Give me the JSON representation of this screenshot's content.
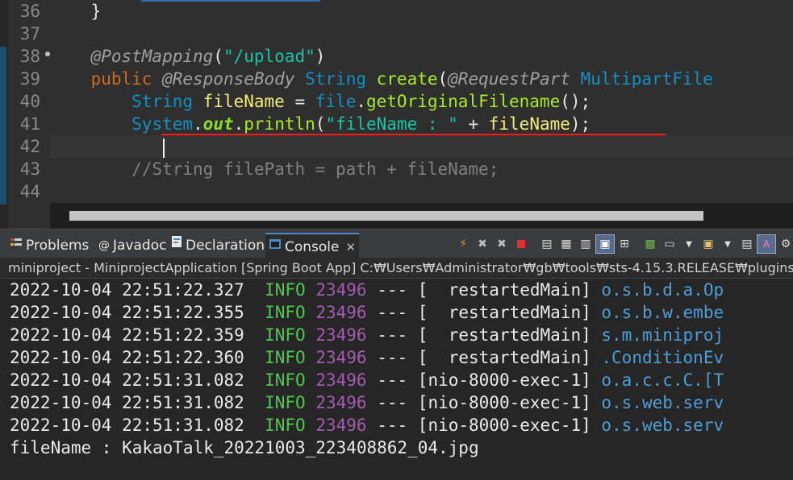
{
  "editor": {
    "line_numbers": [
      "36",
      "37",
      "38",
      "39",
      "40",
      "41",
      "42",
      "43",
      "44"
    ],
    "lines": {
      "l36": {
        "brace": "}"
      },
      "l38": {
        "ann": "@PostMapping",
        "open": "(",
        "str": "\"/upload\"",
        "close": ")"
      },
      "l39": {
        "kw": "public",
        "ann1": "@ResponseBody",
        "type1": "String",
        "method": "create",
        "open": "(",
        "ann2": "@RequestPart",
        "type2": "MultipartFile"
      },
      "l40": {
        "type": "String",
        "var": "fileName",
        "eq": " = ",
        "obj": "file",
        "dot": ".",
        "method": "getOriginalFilename",
        "end": "();"
      },
      "l41": {
        "cls": "System",
        "dot1": ".",
        "field": "out",
        "dot2": ".",
        "method": "println",
        "open": "(",
        "str": "\"fileName : \"",
        "plus": " + ",
        "var": "fileName",
        "end": ");"
      },
      "l43": {
        "comment": "//String filePath = path + fileName;"
      }
    }
  },
  "tabs": [
    {
      "label": "Problems",
      "icon": "problems-icon"
    },
    {
      "label": "Javadoc",
      "icon": "javadoc-icon"
    },
    {
      "label": "Declaration",
      "icon": "declaration-icon"
    },
    {
      "label": "Console",
      "icon": "console-icon",
      "close": "✕"
    }
  ],
  "console": {
    "header": "miniproject - MiniprojectApplication [Spring Boot App] C:₩Users₩Administrator₩gb₩tools₩sts-4.15.3.RELEASE₩plugins",
    "rows": [
      {
        "ts": "2022-10-04 22:51:22.327",
        "level": "INFO",
        "pid": "23496",
        "sep": "---",
        "thread": "[  restartedMain]",
        "logger": "o.s.b.d.a.Op"
      },
      {
        "ts": "2022-10-04 22:51:22.355",
        "level": "INFO",
        "pid": "23496",
        "sep": "---",
        "thread": "[  restartedMain]",
        "logger": "o.s.b.w.embe"
      },
      {
        "ts": "2022-10-04 22:51:22.359",
        "level": "INFO",
        "pid": "23496",
        "sep": "---",
        "thread": "[  restartedMain]",
        "logger": "s.m.miniproj"
      },
      {
        "ts": "2022-10-04 22:51:22.360",
        "level": "INFO",
        "pid": "23496",
        "sep": "---",
        "thread": "[  restartedMain]",
        "logger": ".ConditionEv"
      },
      {
        "ts": "2022-10-04 22:51:31.082",
        "level": "INFO",
        "pid": "23496",
        "sep": "---",
        "thread": "[nio-8000-exec-1]",
        "logger": "o.a.c.c.C.[T"
      },
      {
        "ts": "2022-10-04 22:51:31.082",
        "level": "INFO",
        "pid": "23496",
        "sep": "---",
        "thread": "[nio-8000-exec-1]",
        "logger": "o.s.web.serv"
      },
      {
        "ts": "2022-10-04 22:51:31.082",
        "level": "INFO",
        "pid": "23496",
        "sep": "---",
        "thread": "[nio-8000-exec-1]",
        "logger": "o.s.web.serv"
      }
    ],
    "output": "fileName : KakaoTalk_20221003_223408862_04.jpg"
  },
  "toolbar_icons": [
    "pin-icon",
    "terminate-icon",
    "remove-all-icon",
    "stop-icon",
    "scroll-lock-icon",
    "word-wrap-icon",
    "show-console-icon",
    "pin-console-icon",
    "new-console-icon",
    "open-console-icon",
    "display-selected-icon",
    "copy-icon",
    "color-icon",
    "settings-icon"
  ],
  "colors": {
    "editor_bg": "#2f2f2f",
    "keyword": "#cc6c1d",
    "type": "#1290c3",
    "string": "#17c6a3",
    "variable": "#f3ec79",
    "method": "#a7ec21",
    "log_info": "#4ec84e",
    "log_pid": "#a35cb0",
    "logger": "#4c9fd8",
    "highlight": "#ff1a1a"
  }
}
